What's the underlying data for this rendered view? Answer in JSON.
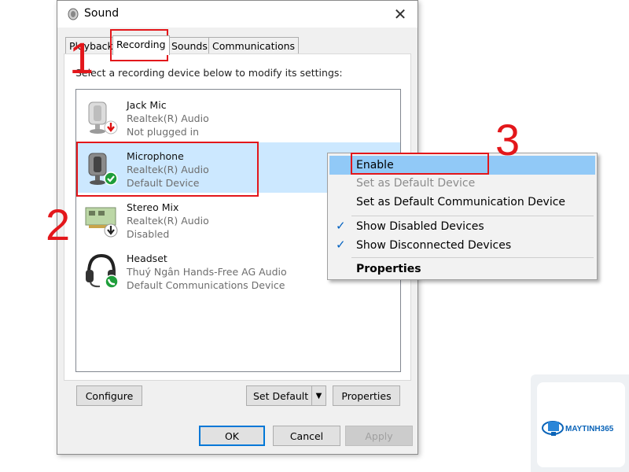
{
  "window": {
    "title": "Sound",
    "close_glyph": "✕"
  },
  "tabs": [
    {
      "label": "Playback"
    },
    {
      "label": "Recording"
    },
    {
      "label": "Sounds"
    },
    {
      "label": "Communications"
    }
  ],
  "instruction": "Select a recording device below to modify its settings:",
  "devices": [
    {
      "name": "Jack Mic",
      "driver": "Realtek(R) Audio",
      "status": "Not plugged in",
      "icon": "microphone-icon",
      "badge": "unplugged-badge-icon"
    },
    {
      "name": "Microphone",
      "driver": "Realtek(R) Audio",
      "status": "Default Device",
      "icon": "microphone-icon",
      "badge": "default-check-badge-icon",
      "selected": true
    },
    {
      "name": "Stereo Mix",
      "driver": "Realtek(R) Audio",
      "status": "Disabled",
      "icon": "sound-card-icon",
      "badge": "disabled-badge-icon"
    },
    {
      "name": "Headset",
      "driver": "Thuý Ngân Hands-Free AG Audio",
      "status": "Default Communications Device",
      "icon": "headset-icon",
      "badge": "phone-badge-icon"
    }
  ],
  "buttons": {
    "configure": "Configure",
    "set_default": "Set Default",
    "properties": "Properties",
    "ok": "OK",
    "cancel": "Cancel",
    "apply": "Apply"
  },
  "context_menu": {
    "enable": "Enable",
    "set_default": "Set as Default Device",
    "set_default_comm": "Set as Default Communication Device",
    "show_disabled": "Show Disabled Devices",
    "show_disconnected": "Show Disconnected Devices",
    "properties": "Properties",
    "check_glyph": "✓"
  },
  "annotations": {
    "step1": "1",
    "step2": "2",
    "step3": "3",
    "highlight_color": "#e3171b"
  },
  "watermark": {
    "brand": "MAYTINH365"
  },
  "colors": {
    "selection": "#cce8ff",
    "menu_highlight": "#91c9f7",
    "default_button_border": "#0078d7"
  }
}
